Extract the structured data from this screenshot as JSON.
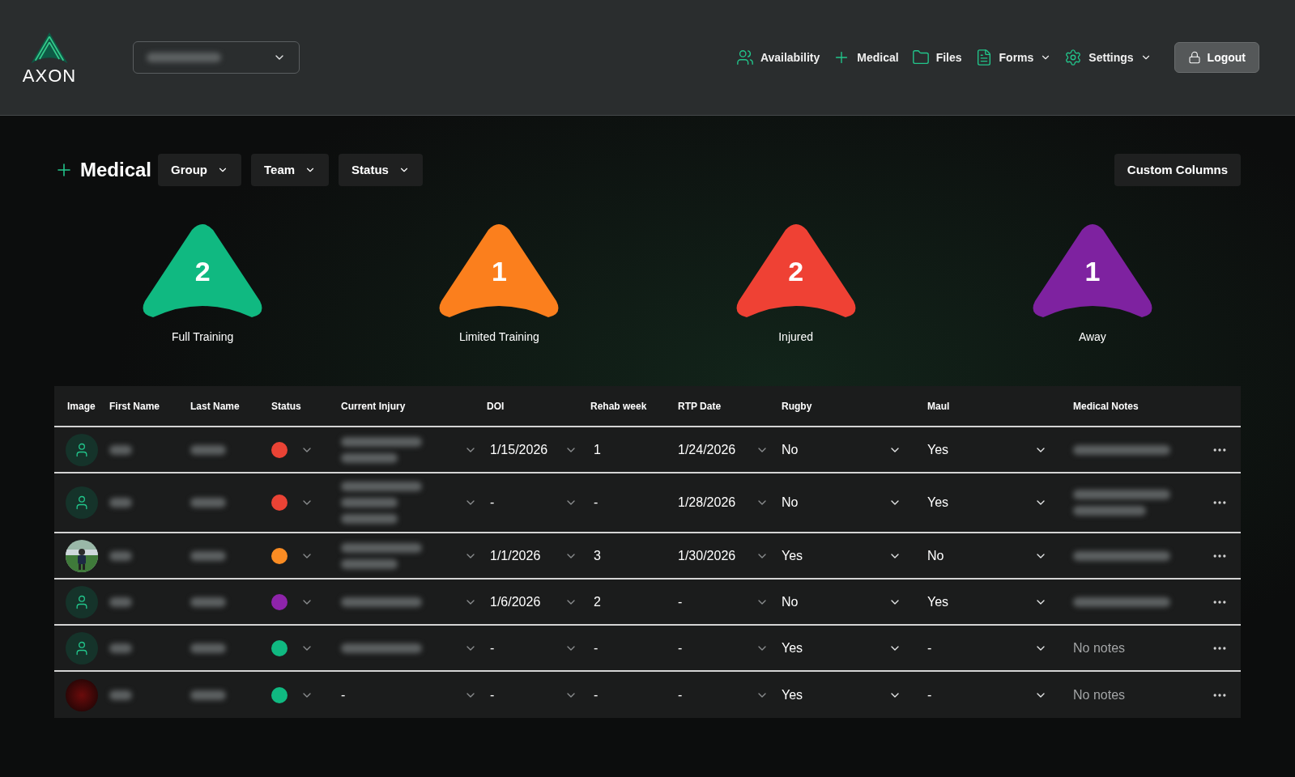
{
  "header": {
    "logo_text": "AXON",
    "nav": [
      {
        "label": "Availability",
        "caret": false
      },
      {
        "label": "Medical",
        "caret": false
      },
      {
        "label": "Files",
        "caret": false
      },
      {
        "label": "Forms",
        "caret": true
      },
      {
        "label": "Settings",
        "caret": true
      }
    ],
    "logout": "Logout"
  },
  "page": {
    "title": "Medical",
    "filters": [
      "Group",
      "Team",
      "Status"
    ],
    "custom_columns": "Custom Columns"
  },
  "summary": [
    {
      "count": "2",
      "label": "Full Training",
      "color": "#10b981"
    },
    {
      "count": "1",
      "label": "Limited Training",
      "color": "#fb7f1d"
    },
    {
      "count": "2",
      "label": "Injured",
      "color": "#ef4134"
    },
    {
      "count": "1",
      "label": "Away",
      "color": "#7e22a0"
    }
  ],
  "table": {
    "columns": [
      "Image",
      "First Name",
      "Last Name",
      "Status",
      "Current Injury",
      "DOI",
      "Rehab week",
      "RTP Date",
      "Rugby",
      "Maul",
      "Medical Notes"
    ],
    "rows": [
      {
        "kind": "avatar",
        "color": "#ea4335",
        "doi": "1/15/2026",
        "rehab": "1",
        "rtp": "1/24/2026",
        "rugby": "No",
        "maul": "Yes"
      },
      {
        "kind": "avatar",
        "color": "#ea4335",
        "doi": "-",
        "rehab": "-",
        "rtp": "1/28/2026",
        "rugby": "No",
        "maul": "Yes"
      },
      {
        "kind": "picture",
        "color": "#fb8c23",
        "doi": "1/1/2026",
        "rehab": "3",
        "rtp": "1/30/2026",
        "rugby": "Yes",
        "maul": "No"
      },
      {
        "kind": "avatar",
        "color": "#8e24aa",
        "doi": "1/6/2026",
        "rehab": "2",
        "rtp": "-",
        "rugby": "No",
        "maul": "Yes"
      },
      {
        "kind": "avatar",
        "color": "#10b981",
        "doi": "-",
        "rehab": "-",
        "rtp": "-",
        "rugby": "Yes",
        "maul": "-",
        "notes": "No notes"
      },
      {
        "kind": "dark",
        "color": "#10b981",
        "injury": "-",
        "doi": "-",
        "rehab": "-",
        "rtp": "-",
        "rugby": "Yes",
        "maul": "-",
        "notes": "No notes"
      }
    ]
  }
}
